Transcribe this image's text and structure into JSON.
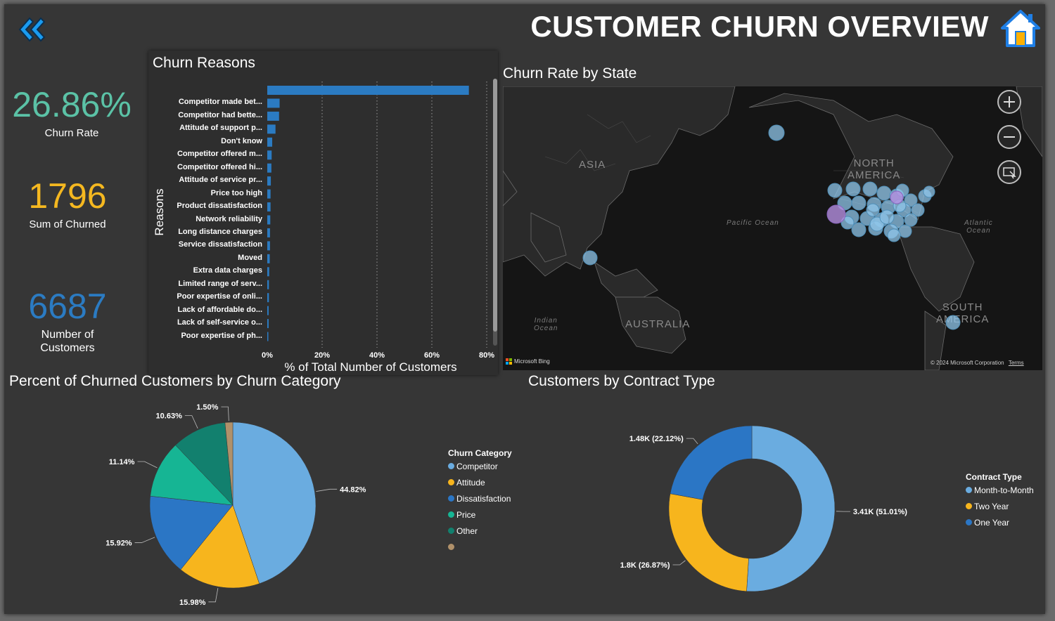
{
  "header": {
    "title": "CUSTOMER CHURN OVERVIEW",
    "back_icon": "double-chevron-left-icon",
    "home_icon": "home-icon"
  },
  "kpis": [
    {
      "value": "26.86%",
      "label": "Churn Rate",
      "color": "#5bc2a6"
    },
    {
      "value": "1796",
      "label": "Sum of Churned",
      "color": "#f5b820"
    },
    {
      "value": "6687",
      "label": "Number of Customers",
      "color": "#2b7bc2"
    }
  ],
  "reasons": {
    "title": "Churn Reasons",
    "ylabel": "Reasons",
    "xlabel": "% of Total Number of Customers"
  },
  "map": {
    "title": "Churn Rate by State",
    "labels": {
      "asia": "ASIA",
      "north_america": "NORTH\nAMERICA",
      "pacific": "Pacific Ocean",
      "atlantic": "Atlantic\nOcean",
      "indian": "Indian\nOcean",
      "australia": "AUSTRALIA",
      "south_america": "SOUTH\nAMERICA"
    },
    "attribution": "Microsoft Bing",
    "copyright": "© 2024 Microsoft Corporation",
    "terms": "Terms",
    "controls": [
      "zoom-in-icon",
      "zoom-out-icon",
      "select-area-icon"
    ]
  },
  "pie": {
    "title": "Percent of Churned Customers by Churn Category",
    "legend_title": "Churn Category"
  },
  "donut": {
    "title": "Customers by Contract Type",
    "legend_title": "Contract Type"
  },
  "chart_data": [
    {
      "type": "bar",
      "orientation": "horizontal",
      "title": "Churn Reasons",
      "xlabel": "% of Total Number of Customers",
      "ylabel": "Reasons",
      "xlim": [
        0,
        80
      ],
      "xticks": [
        "0%",
        "20%",
        "40%",
        "60%",
        "80%"
      ],
      "categories": [
        "",
        "Competitor made bet...",
        "Competitor had bette...",
        "Attitude of support p...",
        "Don't know",
        "Competitor offered m...",
        "Competitor offered hi...",
        "Attitude of service pr...",
        "Price too high",
        "Product dissatisfaction",
        "Network reliability",
        "Long distance charges",
        "Service dissatisfaction",
        "Moved",
        "Extra data charges",
        "Limited range of serv...",
        "Poor expertise of onli...",
        "Lack of affordable do...",
        "Lack of self-service o...",
        "Poor expertise of ph..."
      ],
      "values": [
        73.5,
        4.5,
        4.3,
        3.0,
        1.8,
        1.6,
        1.5,
        1.3,
        1.2,
        1.2,
        1.1,
        1.0,
        1.0,
        0.9,
        0.7,
        0.6,
        0.6,
        0.5,
        0.5,
        0.2
      ],
      "color": "#2b7bc2"
    },
    {
      "type": "pie",
      "title": "Percent of Churned Customers by Churn Category",
      "legend_title": "Churn Category",
      "categories": [
        "Competitor",
        "Attitude",
        "Dissatisfaction",
        "Price",
        "Other",
        ""
      ],
      "values": [
        44.82,
        15.98,
        15.92,
        11.14,
        10.63,
        1.5
      ],
      "labels": [
        "44.82%",
        "15.98%",
        "15.92%",
        "11.14%",
        "10.63%",
        "1.50%"
      ],
      "colors": [
        "#6aace0",
        "#f7b51d",
        "#2b76c5",
        "#16b594",
        "#12806e",
        "#b0916a"
      ]
    },
    {
      "type": "pie",
      "variant": "donut",
      "title": "Customers by Contract Type",
      "legend_title": "Contract Type",
      "categories": [
        "Month-to-Month",
        "Two Year",
        "One Year"
      ],
      "values": [
        51.01,
        26.87,
        22.12
      ],
      "labels": [
        "3.41K (51.01%)",
        "1.8K (26.87%)",
        "1.48K (22.12%)"
      ],
      "colors": [
        "#6aace0",
        "#f7b51d",
        "#2b76c5"
      ]
    }
  ]
}
